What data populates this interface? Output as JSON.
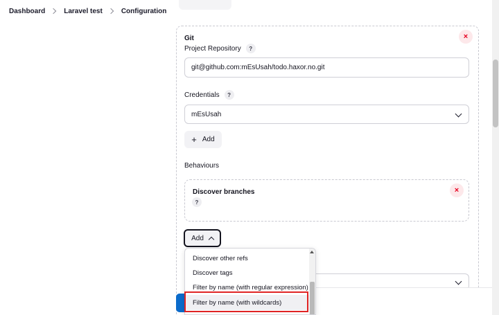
{
  "breadcrumb": [
    "Dashboard",
    "Laravel test",
    "Configuration"
  ],
  "git": {
    "title": "Git",
    "repo_label": "Project Repository",
    "repo_value": "git@github.com:mEsUsah/todo.haxor.no.git",
    "credentials_label": "Credentials",
    "credentials_value": "mEsUsah",
    "add_label": "Add",
    "help_symbol": "?",
    "close_symbol": "×"
  },
  "behaviours": {
    "label": "Behaviours",
    "discover_branches": "Discover branches",
    "add_label": "Add"
  },
  "dropdown": {
    "items": [
      "Discover other refs",
      "Discover tags",
      "Filter by name (with regular expression)",
      "Filter by name (with wildcards)"
    ],
    "highlighted_index": 3
  },
  "icons": {
    "close": "close-icon",
    "help": "help-icon",
    "chevron_down": "chevron-down-icon",
    "chevron_up": "chevron-up-icon",
    "breadcrumb_separator": "chevron-right-icon",
    "plus": "plus-icon"
  },
  "colors": {
    "accent": "#0b6bcb",
    "danger": "#e6001f",
    "highlight": "#e02424"
  }
}
